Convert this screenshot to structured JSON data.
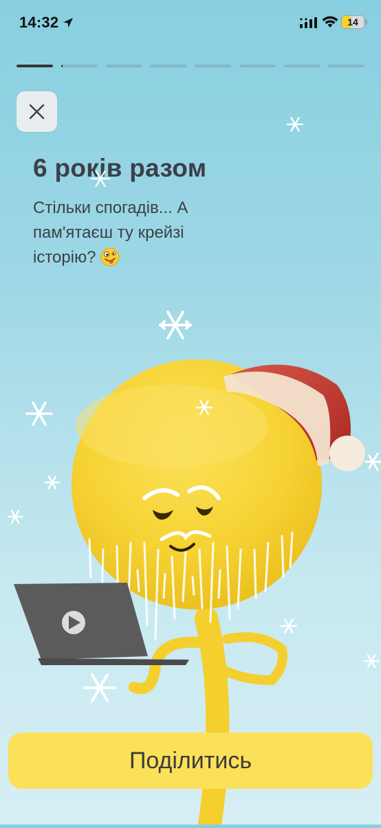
{
  "status_bar": {
    "time": "14:32",
    "battery_level": "14",
    "icons": [
      "location-arrow-icon",
      "cellular-signal-icon",
      "wifi-icon",
      "battery-icon"
    ]
  },
  "progress": {
    "segments_total": 8,
    "current_segment": 1,
    "current_segment_progress": 1.0,
    "next_segment_progress": 0.05
  },
  "colors": {
    "background_top": "#87cfe0",
    "background_bottom": "#d7eff4",
    "accent_yellow": "#fbe05a",
    "text_dark": "#3b4047",
    "close_button_bg": "#e8eef0"
  },
  "story": {
    "title": "6 років разом",
    "subtitle": "Стільки спогадів... А пам'ятаєш ту крейзі історію?",
    "subtitle_emoji": "zany-face-emoji"
  },
  "illustration": {
    "elements": [
      "sun-character",
      "santa-hat",
      "laptop",
      "snowflake-icon"
    ]
  },
  "actions": {
    "close_icon": "close-icon",
    "share_label": "Поділитись"
  }
}
